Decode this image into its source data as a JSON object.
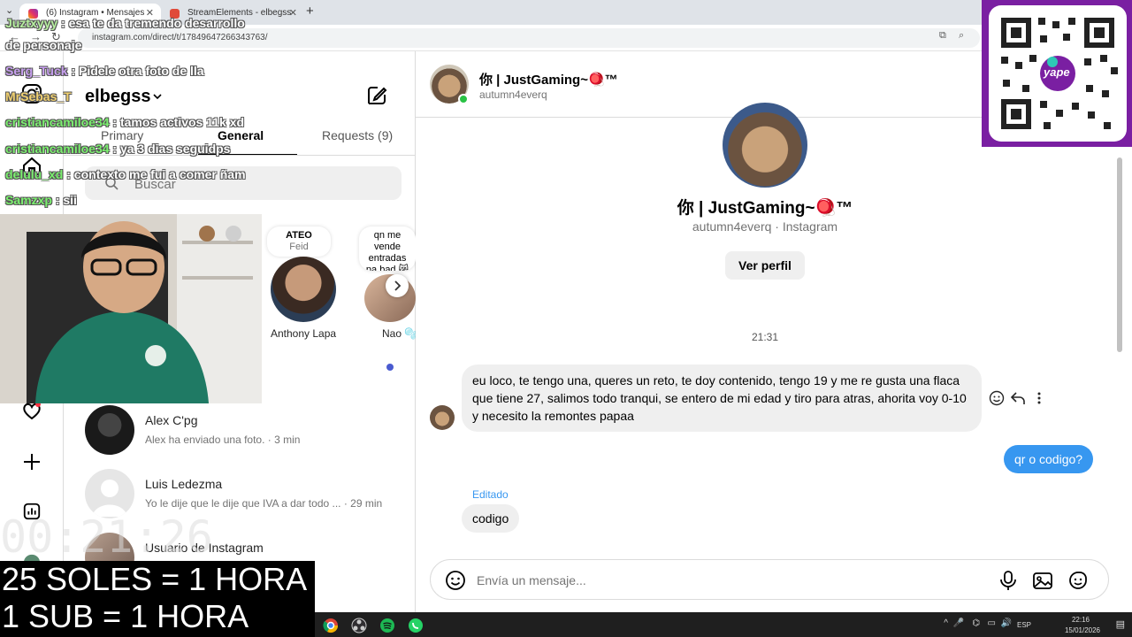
{
  "browser": {
    "tabs": [
      {
        "label": "(6) Instagram • Mensajes",
        "active": true
      },
      {
        "label": "StreamElements - elbegss",
        "active": false
      }
    ],
    "url": "instagram.com/direct/t/17849647266343763/"
  },
  "inbox": {
    "account": "elbegss",
    "tabs": {
      "primary": "Primary",
      "general": "General",
      "requests": "Requests (9)"
    },
    "search_placeholder": "Buscar",
    "notes": [
      {
        "bubble_title": "ATEO",
        "bubble_sub": "Feid",
        "name": "Anthony Lapa"
      },
      {
        "bubble_title": "qn me vende entradas pa bad 😿😭",
        "name": "Nao 🫧"
      }
    ],
    "conversations": [
      {
        "name": "Alex C'pg",
        "preview": "Alex ha enviado una foto. · 3 min"
      },
      {
        "name": "Luis Ledezma",
        "preview": "Yo le dije que le dije que IVA a dar todo ... · 29 min"
      },
      {
        "name": "Usuario de Instagram",
        "preview": ""
      }
    ]
  },
  "chat": {
    "header_name": "你 | JustGaming~🪀™",
    "header_user": "autumn4everq",
    "profile_name": "你 | JustGaming~🪀™",
    "profile_sub": "autumn4everq · Instagram",
    "view_profile": "Ver perfil",
    "timestamp": "21:31",
    "messages": [
      {
        "from": "them",
        "text": "eu loco, te tengo una, queres un reto, te doy contenido, tengo 19 y me re gusta una flaca que tiene 27, salimos todo tranqui, se entero de mi edad y tiro para atras, ahorita voy 0-10 y necesito la remontes papaa"
      },
      {
        "from": "me",
        "text": "qr o codigo?"
      },
      {
        "from": "them",
        "text": "codigo",
        "edited_label": "Editado"
      }
    ],
    "composer_placeholder": "Envía un mensaje..."
  },
  "overlay": {
    "chat": [
      {
        "user": "Juztxyyy",
        "text": ": esa te da tremendo desarrollo",
        "color": "#b7f0a0"
      },
      {
        "user": "",
        "text": "de personaje",
        "color": "#ffffff"
      },
      {
        "user": "Serg_Tuck",
        "text": ": Pidele otra foto de lla",
        "color": "#c8a0f0"
      },
      {
        "user": "MrSebas_T",
        "text": "",
        "color": "#f0d070"
      },
      {
        "user": "cristiancamiloe34",
        "text": ": tamos activos 11k xd",
        "color": "#7cf070"
      },
      {
        "user": "cristiancamiloe34",
        "text": ": ya 3 dias seguidps",
        "color": "#7cf070"
      },
      {
        "user": "delulu_xd",
        "text": ": contexto me fui a comer ñam",
        "color": "#7cf070"
      },
      {
        "user": "Samzxp",
        "text": ": sii",
        "color": "#7cf070"
      }
    ],
    "timer": "00:21:26",
    "promo_line1": "25 SOLES = 1 HORA",
    "promo_line2": "1 SUB = 1 HORA",
    "qr_brand": "yape"
  },
  "taskbar": {
    "lang": "ESP",
    "time": "22:16",
    "date": "15/01/2026"
  },
  "colors": {
    "accent_blue": "#3797f0",
    "overlay_purple": "#7a1fa2"
  }
}
